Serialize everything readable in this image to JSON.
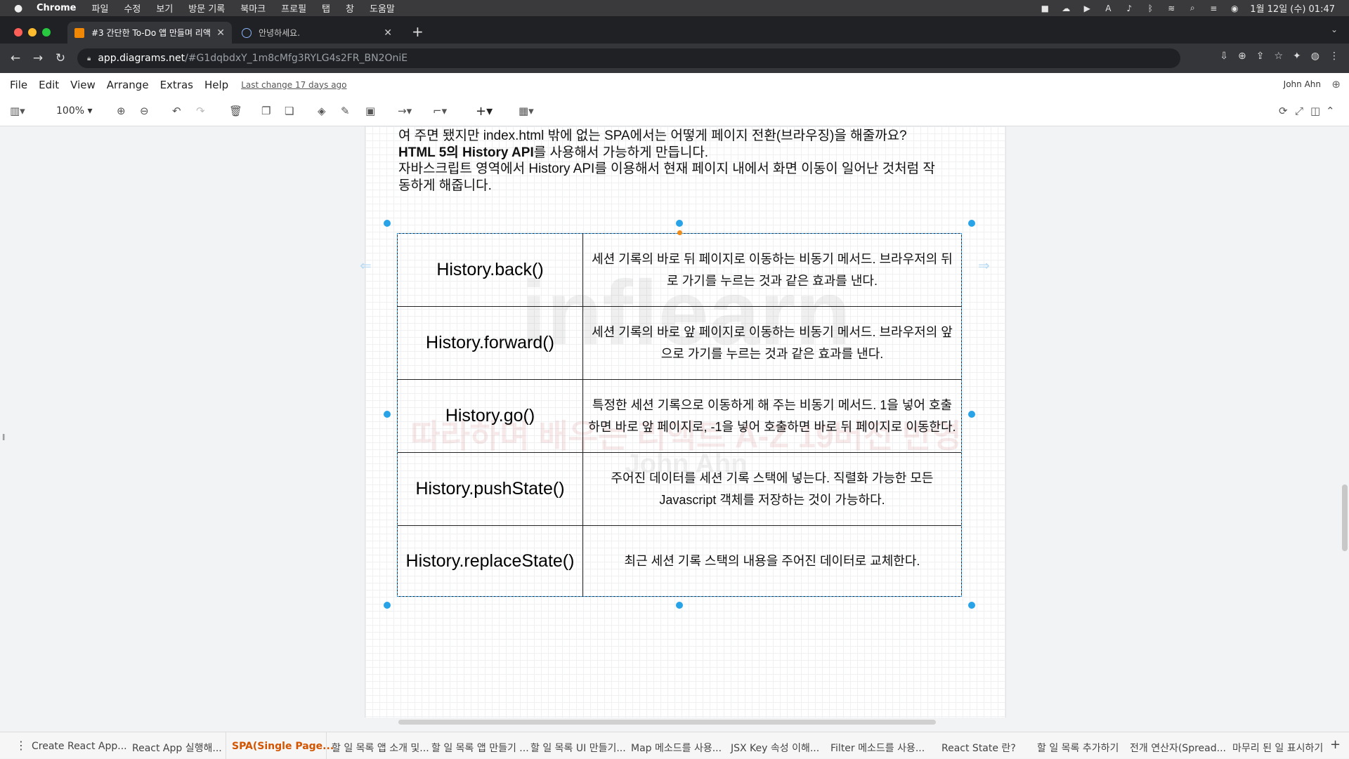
{
  "macos": {
    "app_name": "Chrome",
    "menus": [
      "파일",
      "수정",
      "보기",
      "방문 기록",
      "북마크",
      "프로필",
      "탭",
      "창",
      "도움말"
    ],
    "clock": "1월 12일 (수) 01:47"
  },
  "browser": {
    "tabs": [
      {
        "title": "#3 간단한 To-Do 앱 만들며 리액트"
      },
      {
        "title": "안녕하세요."
      }
    ],
    "url_host": "app.diagrams.net",
    "url_path": "/#G1dqbdxY_1m8cMfg3RYLG4s2FR_BN2OniE"
  },
  "drawio": {
    "menus": [
      "File",
      "Edit",
      "View",
      "Arrange",
      "Extras",
      "Help"
    ],
    "last_change": "Last change 17 days ago",
    "user": "John Ahn",
    "zoom": "100%"
  },
  "content": {
    "text_lines": [
      "여 주면 됐지만 index.html 밖에 없는 SPA에서는 어떻게 페이지 전환(브라우징)을 해줄까요?",
      "HTML 5의 History API",
      "를 사용해서 가능하게 만듭니다.",
      "자바스크립트 영역에서 History API를 이용해서 현재 페이지 내에서 화면 이동이 일어난 것처럼 작",
      "동하게 해줍니다."
    ],
    "table": [
      {
        "method": "History.back()",
        "desc": "세션 기록의 바로 뒤 페이지로 이동하는 비동기 메서드. 브라우저의 뒤로 가기를 누르는 것과 같은 효과를 낸다."
      },
      {
        "method": "History.forward()",
        "desc": "세션 기록의 바로 앞 페이지로 이동하는 비동기 메서드. 브라우저의 앞으로 가기를 누르는 것과 같은 효과를 낸다."
      },
      {
        "method": "History.go()",
        "desc": "특정한 세션 기록으로 이동하게 해 주는 비동기 메서드. 1을 넣어 호출하면 바로 앞 페이지로, -1을 넣어 호출하면 바로 뒤 페이지로 이동한다."
      },
      {
        "method": "History.pushState()",
        "desc": "주어진 데이터를 세션 기록 스택에 넣는다. 직렬화 가능한 모든 Javascript 객체를 저장하는 것이 가능하다."
      },
      {
        "method": "History.replaceState()",
        "desc": "최근 세션 기록 스택의 내용을 주어진 데이터로 교체한다."
      }
    ],
    "watermark_brand": "inflearn",
    "watermark_title": "따라하며 배우는 리액트 A-Z 19버전 반영",
    "watermark_author": "John Ahn"
  },
  "page_tabs": [
    {
      "label": "Create React App...",
      "active": false
    },
    {
      "label": "React App 실행해...",
      "active": false
    },
    {
      "label": "SPA(Single Page...",
      "active": true
    },
    {
      "label": "할 일 목록 앱 소개 및...",
      "active": false
    },
    {
      "label": "할 일 목록 앱 만들기 ...",
      "active": false
    },
    {
      "label": "할 일 목록 UI 만들기...",
      "active": false
    },
    {
      "label": "Map 메소드를 사용...",
      "active": false
    },
    {
      "label": "JSX Key 속성 이해...",
      "active": false
    },
    {
      "label": "Filter 메소드를 사용...",
      "active": false
    },
    {
      "label": "React State 란?",
      "active": false
    },
    {
      "label": "할 일 목록 추가하기",
      "active": false
    },
    {
      "label": "전개 연산자(Spread...",
      "active": false
    },
    {
      "label": "마무리 된 일 표시하기",
      "active": false
    }
  ]
}
